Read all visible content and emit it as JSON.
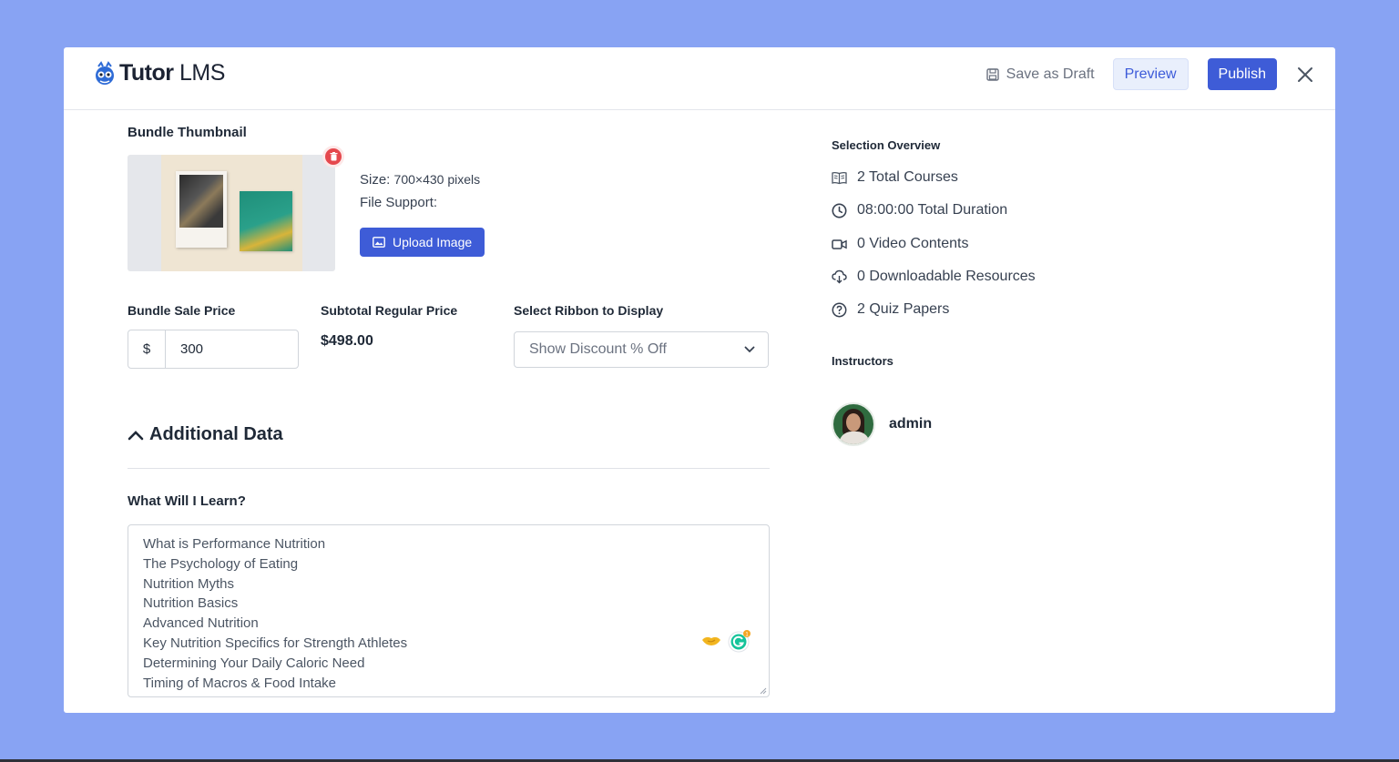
{
  "header": {
    "logo_text_bold": "Tutor",
    "logo_text_light": "LMS",
    "save_draft_label": "Save as Draft",
    "preview_label": "Preview",
    "publish_label": "Publish"
  },
  "thumbnail": {
    "label": "Bundle Thumbnail",
    "size_label": "Size:",
    "size_value": "700×430 pixels",
    "file_support_label": "File Support:",
    "upload_label": "Upload Image"
  },
  "pricing": {
    "sale_price_label": "Bundle Sale Price",
    "currency_symbol": "$",
    "sale_price_value": "300",
    "regular_price_label": "Subtotal Regular Price",
    "regular_price_value": "$498.00",
    "ribbon_label": "Select Ribbon to Display",
    "ribbon_selected": "Show Discount % Off"
  },
  "additional": {
    "title": "Additional Data",
    "learn_label": "What Will I Learn?",
    "learn_items": [
      "What is Performance Nutrition",
      "The Psychology of Eating",
      "Nutrition Myths",
      "Nutrition Basics",
      "Advanced Nutrition",
      "Key Nutrition Specifics for Strength Athletes",
      "Determining Your Daily Caloric Need",
      "Timing of Macros & Food Intake"
    ]
  },
  "overview": {
    "title": "Selection Overview",
    "items": [
      {
        "icon": "book-icon",
        "text": "2 Total Courses"
      },
      {
        "icon": "clock-icon",
        "text": "08:00:00 Total Duration"
      },
      {
        "icon": "video-icon",
        "text": "0 Video Contents"
      },
      {
        "icon": "cloud-download-icon",
        "text": "0 Downloadable Resources"
      },
      {
        "icon": "question-circle-icon",
        "text": "2 Quiz Papers"
      }
    ]
  },
  "instructors": {
    "title": "Instructors",
    "list": [
      {
        "name": "admin"
      }
    ]
  },
  "colors": {
    "background": "#88a3f3",
    "primary": "#3e5cd7",
    "danger": "#e5484d"
  }
}
